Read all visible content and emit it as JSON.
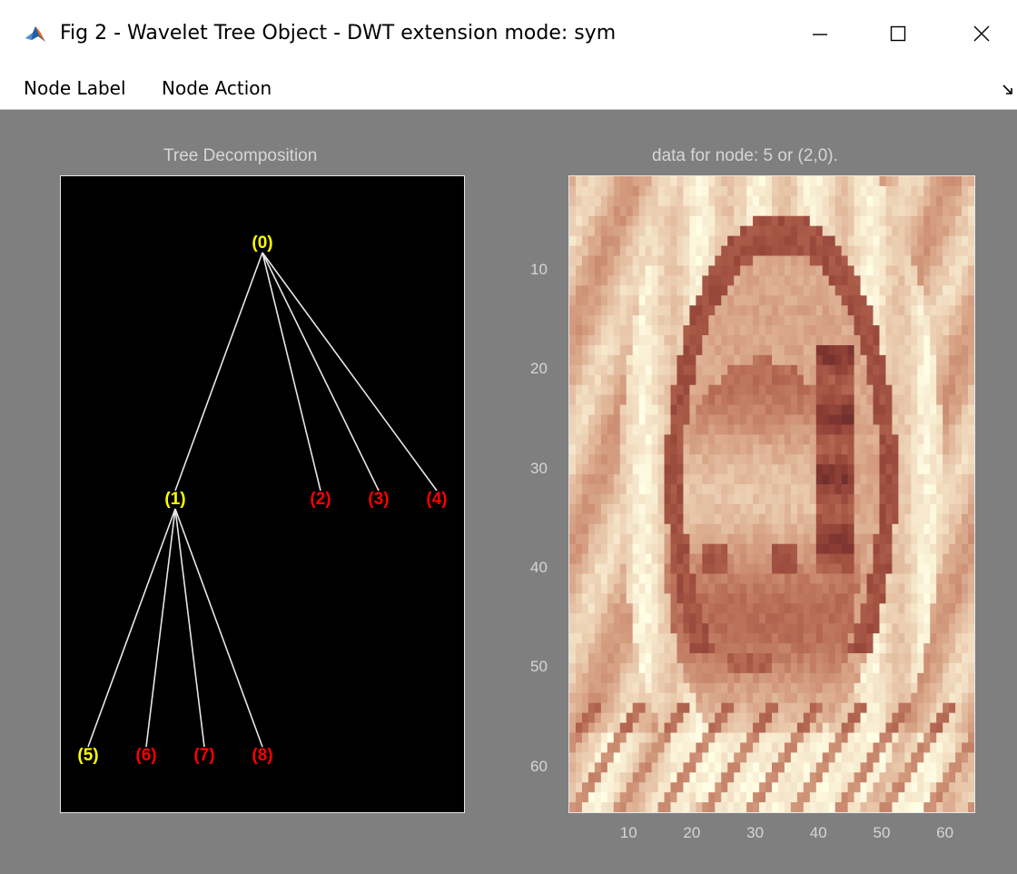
{
  "window": {
    "title": "Fig 2 - Wavelet Tree Object - DWT extension mode: sym",
    "icon": "matlab-icon"
  },
  "menu": {
    "items": [
      "Node Label",
      "Node Action"
    ]
  },
  "tree": {
    "title": "Tree Decomposition",
    "nodes": [
      {
        "label": "(0)",
        "color": "#ffff00"
      },
      {
        "label": "(1)",
        "color": "#ffff00"
      },
      {
        "label": "(2)",
        "color": "#ff0000"
      },
      {
        "label": "(3)",
        "color": "#ff0000"
      },
      {
        "label": "(4)",
        "color": "#ff0000"
      },
      {
        "label": "(5)",
        "color": "#ffff00"
      },
      {
        "label": "(6)",
        "color": "#ff0000"
      },
      {
        "label": "(7)",
        "color": "#ff0000"
      },
      {
        "label": "(8)",
        "color": "#ff0000"
      }
    ],
    "edges": [
      [
        0,
        1
      ],
      [
        0,
        2
      ],
      [
        0,
        3
      ],
      [
        0,
        4
      ],
      [
        1,
        5
      ],
      [
        1,
        6
      ],
      [
        1,
        7
      ],
      [
        1,
        8
      ]
    ],
    "line_color": "#e6e6e6"
  },
  "image": {
    "title": "data for node: 5 or (2,0).",
    "colormap": "pink",
    "y_ticks": [
      "10",
      "20",
      "30",
      "40",
      "50",
      "60"
    ],
    "x_ticks": [
      "10",
      "20",
      "30",
      "40",
      "50",
      "60"
    ],
    "y_tick_values": [
      10,
      20,
      30,
      40,
      50,
      60
    ],
    "x_tick_values": [
      10,
      20,
      30,
      40,
      50,
      60
    ],
    "xlim": [
      0.5,
      64.5
    ],
    "ylim": [
      0.5,
      64.5
    ]
  },
  "colors": {
    "figure_bg": "#7f7f7f",
    "axes_bg": "#000000",
    "text_gray": "#d6d6d6"
  }
}
